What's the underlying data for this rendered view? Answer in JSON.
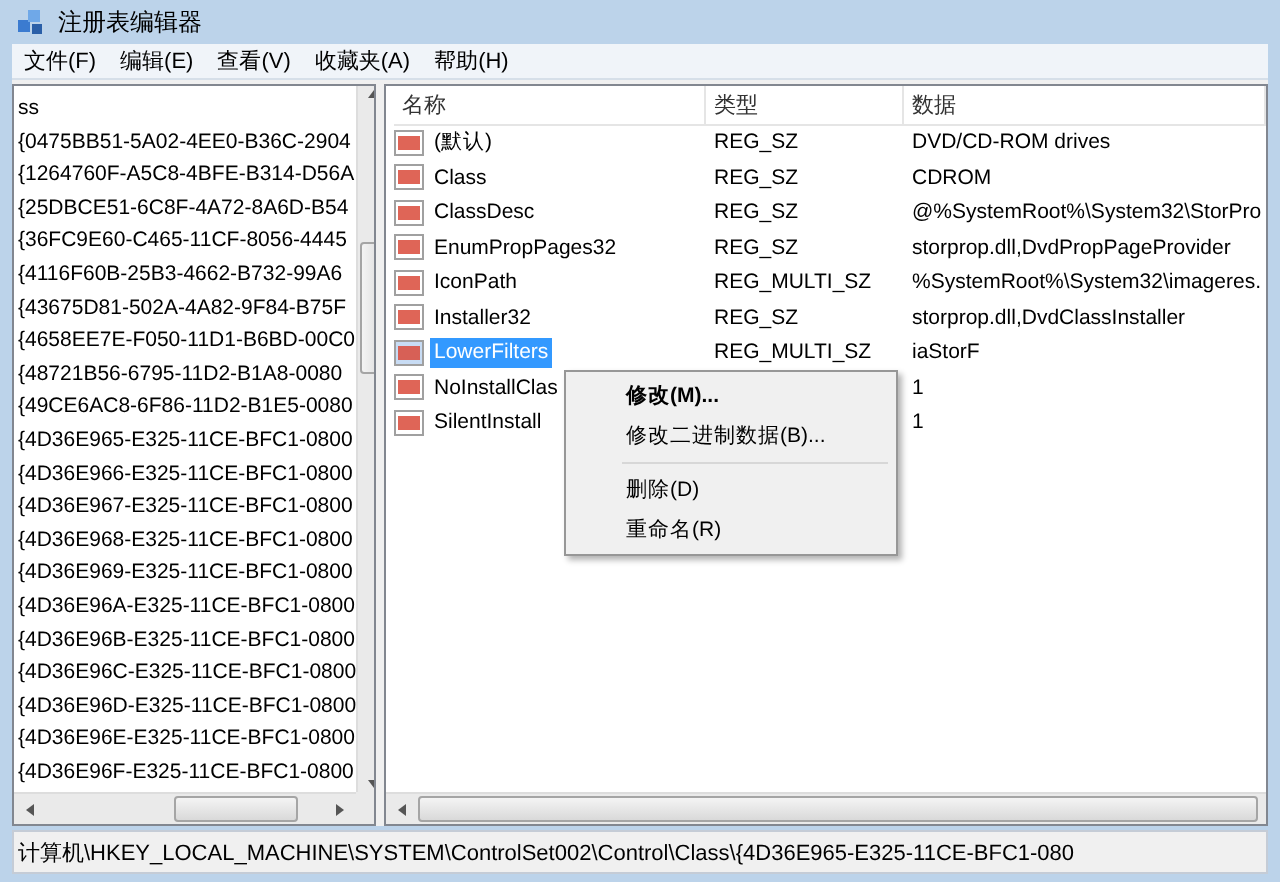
{
  "window": {
    "title": "注册表编辑器"
  },
  "menu": [
    "文件(F)",
    "编辑(E)",
    "查看(V)",
    "收藏夹(A)",
    "帮助(H)"
  ],
  "tree": {
    "items": [
      {
        "label": "ss"
      },
      {
        "label": "{0475BB51-5A02-4EE0-B36C-2904"
      },
      {
        "label": "{1264760F-A5C8-4BFE-B314-D56A"
      },
      {
        "label": "{25DBCE51-6C8F-4A72-8A6D-B54"
      },
      {
        "label": "{36FC9E60-C465-11CF-8056-4445"
      },
      {
        "label": "{4116F60B-25B3-4662-B732-99A6"
      },
      {
        "label": "{43675D81-502A-4A82-9F84-B75F"
      },
      {
        "label": "{4658EE7E-F050-11D1-B6BD-00C0"
      },
      {
        "label": "{48721B56-6795-11D2-B1A8-0080"
      },
      {
        "label": "{49CE6AC8-6F86-11D2-B1E5-0080"
      },
      {
        "label": "{4D36E965-E325-11CE-BFC1-0800"
      },
      {
        "label": "{4D36E966-E325-11CE-BFC1-0800"
      },
      {
        "label": "{4D36E967-E325-11CE-BFC1-0800"
      },
      {
        "label": "{4D36E968-E325-11CE-BFC1-0800"
      },
      {
        "label": "{4D36E969-E325-11CE-BFC1-0800"
      },
      {
        "label": "{4D36E96A-E325-11CE-BFC1-0800"
      },
      {
        "label": "{4D36E96B-E325-11CE-BFC1-0800"
      },
      {
        "label": "{4D36E96C-E325-11CE-BFC1-0800"
      },
      {
        "label": "{4D36E96D-E325-11CE-BFC1-0800"
      },
      {
        "label": "{4D36E96E-E325-11CE-BFC1-0800"
      },
      {
        "label": "{4D36E96F-E325-11CE-BFC1-0800"
      }
    ]
  },
  "values": {
    "columns": [
      "名称",
      "类型",
      "数据"
    ],
    "rows": [
      {
        "name": "(默认)",
        "type": "REG_SZ",
        "data": "DVD/CD-ROM drives",
        "selected": false
      },
      {
        "name": "Class",
        "type": "REG_SZ",
        "data": "CDROM",
        "selected": false
      },
      {
        "name": "ClassDesc",
        "type": "REG_SZ",
        "data": "@%SystemRoot%\\System32\\StorPro",
        "selected": false
      },
      {
        "name": "EnumPropPages32",
        "type": "REG_SZ",
        "data": "storprop.dll,DvdPropPageProvider",
        "selected": false
      },
      {
        "name": "IconPath",
        "type": "REG_MULTI_SZ",
        "data": "%SystemRoot%\\System32\\imageres.",
        "selected": false
      },
      {
        "name": "Installer32",
        "type": "REG_SZ",
        "data": "storprop.dll,DvdClassInstaller",
        "selected": false
      },
      {
        "name": "LowerFilters",
        "type": "REG_MULTI_SZ",
        "data": "iaStorF",
        "selected": true
      },
      {
        "name": "NoInstallClas",
        "type": "",
        "data": "1",
        "selected": false
      },
      {
        "name": "SilentInstall",
        "type": "",
        "data": "1",
        "selected": false
      }
    ]
  },
  "context_menu": [
    {
      "label": "修改(M)...",
      "kind": "default"
    },
    {
      "label": "修改二进制数据(B)...",
      "kind": "item"
    },
    {
      "kind": "separator"
    },
    {
      "label": "删除(D)",
      "kind": "item"
    },
    {
      "label": "重命名(R)",
      "kind": "item"
    }
  ],
  "status_bar": "计算机\\HKEY_LOCAL_MACHINE\\SYSTEM\\ControlSet002\\Control\\Class\\{4D36E965-E325-11CE-BFC1-080"
}
